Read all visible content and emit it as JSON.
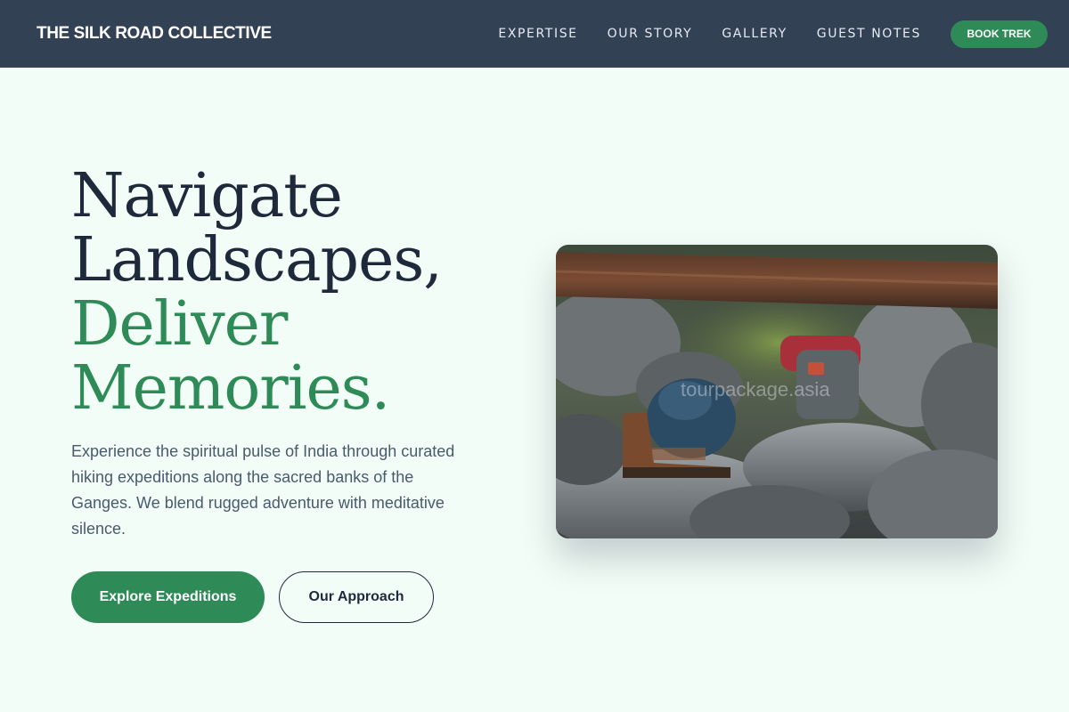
{
  "brand": "THE SILK ROAD COLLECTIVE",
  "nav": {
    "links": [
      "EXPERTISE",
      "OUR STORY",
      "GALLERY",
      "GUEST NOTES"
    ],
    "cta": "BOOK TREK"
  },
  "hero": {
    "title_dark_1": "Navigate",
    "title_dark_2": "Landscapes,",
    "title_green_1": "Deliver",
    "title_green_2": "Memories.",
    "description": "Experience the spiritual pulse of India through curated hiking expeditions along the sacred banks of the Ganges. We blend rugged adventure with meditative silence.",
    "primary_button": "Explore Expeditions",
    "secondary_button": "Our Approach"
  },
  "photo": {
    "subject": "hiking boots and backpacks resting on river rocks under a fallen log",
    "watermark": "tourpackage.asia"
  },
  "colors": {
    "nav_bg": "#334155",
    "accent_green": "#2e8b57",
    "page_bg": "#f2fdf7",
    "text_dark": "#1e293b"
  }
}
